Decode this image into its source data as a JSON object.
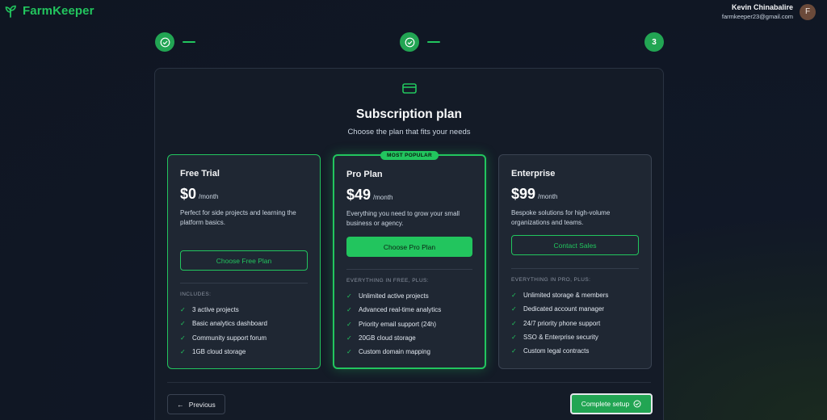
{
  "app": {
    "name": "FarmKeeper",
    "accent": "#22c55e"
  },
  "user": {
    "name": "Kevin Chinabalire",
    "email": "farmkeeper23@gmail.com",
    "initial": "F"
  },
  "stepper": {
    "steps": [
      {
        "state": "complete"
      },
      {
        "state": "complete"
      },
      {
        "state": "current",
        "label": "3"
      }
    ]
  },
  "page": {
    "icon": "credit-card-icon",
    "title": "Subscription plan",
    "subtitle": "Choose the plan that fits your needs"
  },
  "plans": [
    {
      "name": "Free Trial",
      "price": "$0",
      "period": "/month",
      "description": "Perfect for side projects and learning the platform basics.",
      "button": "Choose Free Plan",
      "features_title": "INCLUDES:",
      "features": [
        "3 active projects",
        "Basic analytics dashboard",
        "Community support forum",
        "1GB cloud storage"
      ]
    },
    {
      "name": "Pro Plan",
      "badge": "MOST POPULAR",
      "price": "$49",
      "period": "/month",
      "description": "Everything you need to grow your small business or agency.",
      "button": "Choose Pro Plan",
      "features_title": "EVERYTHING IN FREE, PLUS:",
      "features": [
        "Unlimited active projects",
        "Advanced real-time analytics",
        "Priority email support (24h)",
        "20GB cloud storage",
        "Custom domain mapping"
      ]
    },
    {
      "name": "Enterprise",
      "price": "$99",
      "period": "/month",
      "description": "Bespoke solutions for high-volume organizations and teams.",
      "button": "Contact Sales",
      "features_title": "EVERYTHING IN PRO, PLUS:",
      "features": [
        "Unlimited storage & members",
        "Dedicated account manager",
        "24/7 priority phone support",
        "SSO & Enterprise security",
        "Custom legal contracts"
      ]
    }
  ],
  "footer": {
    "previous": "Previous",
    "complete": "Complete setup"
  }
}
